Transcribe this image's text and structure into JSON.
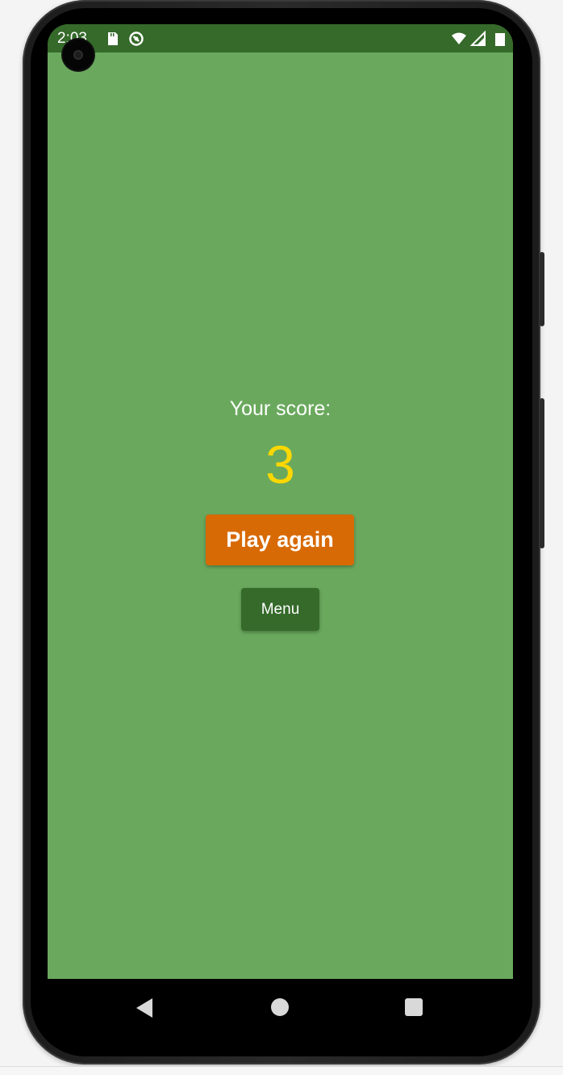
{
  "status_bar": {
    "time": "2:03",
    "icons": [
      "sd-card-icon",
      "data-saver-icon",
      "wifi-icon",
      "signal-icon",
      "battery-icon"
    ]
  },
  "game_over": {
    "score_label": "Your score:",
    "score_value": "3",
    "play_again_label": "Play again",
    "menu_label": "Menu"
  },
  "nav_bar": {
    "icons": [
      "back-icon",
      "home-icon",
      "recents-icon"
    ]
  },
  "colors": {
    "background": "#6aa95d",
    "status_bar": "#356a2a",
    "score_value": "#ffd700",
    "play_again_button": "#d86a06",
    "menu_button": "#356a2a"
  }
}
